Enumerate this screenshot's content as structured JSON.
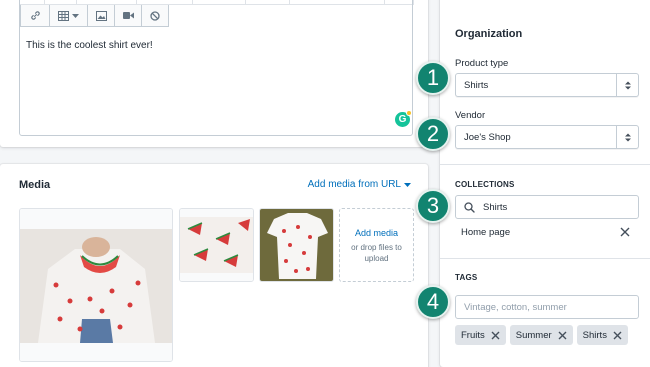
{
  "editor": {
    "body_text": "This is the coolest shirt ever!",
    "toolbar_buttons": [
      "link-icon",
      "table-icon",
      "image-icon",
      "video-icon",
      "block-icon"
    ]
  },
  "media": {
    "title": "Media",
    "add_link_label": "Add media from URL",
    "add_media_title": "Add media",
    "add_media_sub": "or drop files to upload"
  },
  "organization": {
    "title": "Organization",
    "product_type_label": "Product type",
    "product_type_value": "Shirts",
    "vendor_label": "Vendor",
    "vendor_value": "Joe's Shop",
    "collections_heading": "COLLECTIONS",
    "collections_search_value": "Shirts",
    "collections_items": [
      "Home page"
    ],
    "tags_heading": "TAGS",
    "tags_placeholder": "Vintage, cotton, summer",
    "tags": [
      "Fruits",
      "Summer",
      "Shirts"
    ]
  },
  "callouts": [
    "1",
    "2",
    "3",
    "4"
  ],
  "colors": {
    "accent": "#006fbb",
    "callout": "#128470",
    "tag_bg": "#dfe3e8"
  }
}
